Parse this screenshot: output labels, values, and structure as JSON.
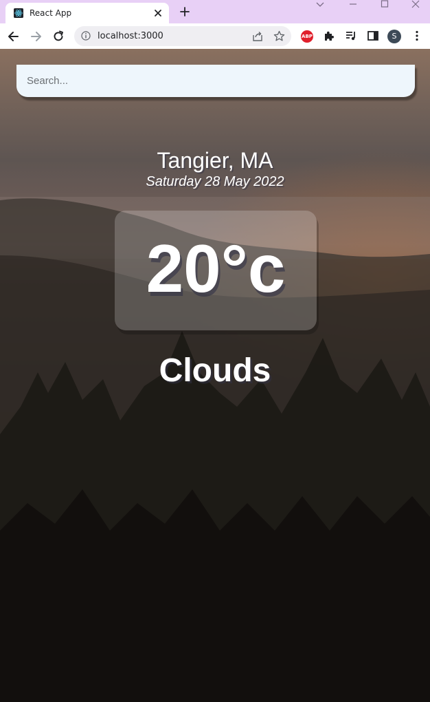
{
  "browser": {
    "tab_title": "React App",
    "url": "localhost:3000",
    "profile_initial": "S",
    "abp_label": "ABP"
  },
  "search": {
    "placeholder": "Search..."
  },
  "weather": {
    "location": "Tangier, MA",
    "date": "Saturday 28 May 2022",
    "temperature": "20°c",
    "condition": "Clouds"
  },
  "colors": {
    "tabbar": "#e8d0f6",
    "search_bg": "#eef6fc",
    "text": "#ffffff",
    "avatar": "#3d4a57"
  }
}
